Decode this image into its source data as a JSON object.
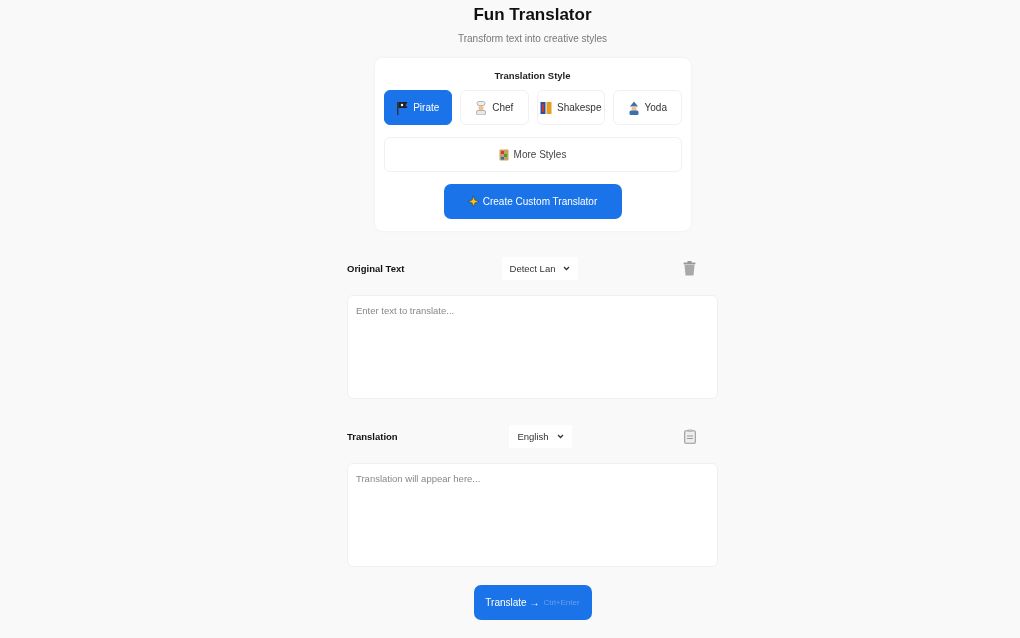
{
  "header": {
    "title": "Fun Translator",
    "subtitle": "Transform text into creative styles"
  },
  "style_panel": {
    "heading": "Translation Style",
    "styles": [
      {
        "label": "Pirate",
        "kind": "flag",
        "selected": true
      },
      {
        "label": "Chef",
        "kind": "chef",
        "selected": false
      },
      {
        "label": "Shakespe",
        "kind": "book",
        "selected": false
      },
      {
        "label": "Yoda",
        "kind": "wizard",
        "selected": false
      }
    ],
    "more_button": "More Styles",
    "custom_button": "Create Custom Translator"
  },
  "source": {
    "label": "Original Text",
    "language": "Detect Lan",
    "placeholder": "Enter text to translate..."
  },
  "target": {
    "label": "Translation",
    "language": "English",
    "placeholder": "Translation will appear here..."
  },
  "translate_button": {
    "label": "Translate →",
    "hint": "Ctrl+Enter"
  }
}
